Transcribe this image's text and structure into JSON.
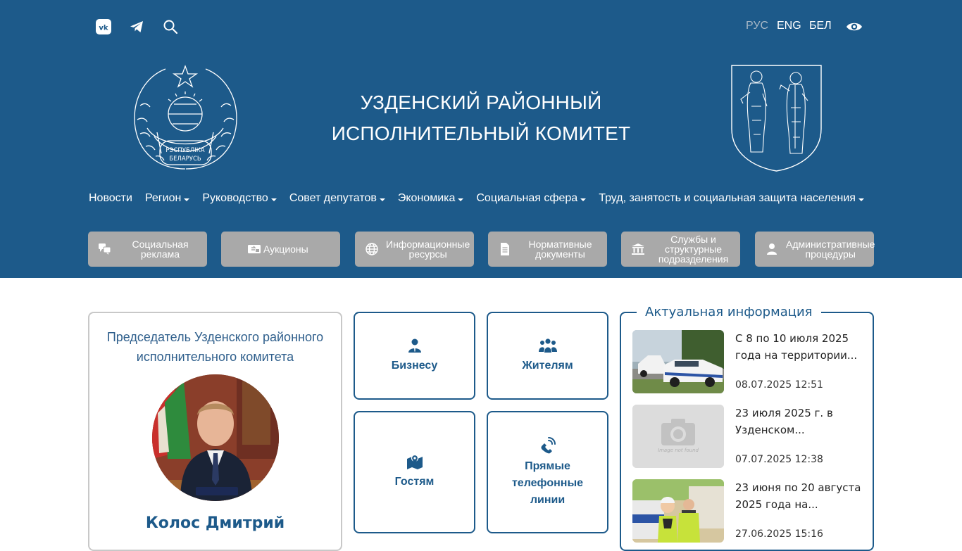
{
  "header": {
    "title_line1": "УЗДЕНСКИЙ РАЙОННЫЙ",
    "title_line2": "ИСПОЛНИТЕЛЬНЫЙ КОМИТЕТ",
    "emblem_text_line1": "РЭСПУБЛІКА",
    "emblem_text_line2": "БЕЛАРУСЬ",
    "languages": [
      {
        "label": "РУС",
        "active": true
      },
      {
        "label": "ENG",
        "active": false
      },
      {
        "label": "БЕЛ",
        "active": false
      }
    ],
    "icons": [
      "vk-icon",
      "telegram-icon",
      "search-icon",
      "eye-icon"
    ]
  },
  "nav": [
    {
      "label": "Новости",
      "dropdown": false
    },
    {
      "label": "Регион",
      "dropdown": true
    },
    {
      "label": "Руководство",
      "dropdown": true
    },
    {
      "label": "Совет депутатов",
      "dropdown": true
    },
    {
      "label": "Экономика",
      "dropdown": true
    },
    {
      "label": "Социальная сфера",
      "dropdown": true
    },
    {
      "label": "Труд, занятость и социальная защита населения",
      "dropdown": true
    }
  ],
  "quick_links": [
    {
      "label": "Социальная реклама",
      "icon": "chat-bubbles-icon"
    },
    {
      "label": "Аукционы",
      "icon": "auction-icon"
    },
    {
      "label": "Информационные ресурсы",
      "icon": "globe-icon"
    },
    {
      "label": "Нормативные документы",
      "icon": "document-icon"
    },
    {
      "label": "Службы и структурные подразделения",
      "icon": "institution-icon"
    },
    {
      "label": "Административные процедуры",
      "icon": "user-icon"
    }
  ],
  "chairman": {
    "title": "Председатель Узденского районного исполнительного комитета",
    "name": "Колос Дмитрий"
  },
  "tiles": [
    {
      "label": "Бизнесу",
      "icon": "business-person-icon"
    },
    {
      "label": "Жителям",
      "icon": "people-icon"
    },
    {
      "label": "Гостям",
      "icon": "map-pin-icon"
    },
    {
      "label": "Прямые телефонные линии",
      "icon": "phone-icon"
    }
  ],
  "news": {
    "heading": "Актуальная информация",
    "items": [
      {
        "text": "С 8 по 10 июля 2025 года на территории...",
        "date": "08.07.2025 12:51",
        "thumb": "police-cars-photo"
      },
      {
        "text": "23 июля 2025 г. в Узденском...",
        "date": "07.07.2025 12:38",
        "thumb": "placeholder-photo",
        "placeholder_text": "Image not found"
      },
      {
        "text": "23 июня по 20 августа 2025 года на...",
        "date": "27.06.2025 15:16",
        "thumb": "child-police-photo"
      }
    ]
  },
  "colors": {
    "header_bg": "#1d5a8a",
    "quick_btn_bg": "#a9a9a9",
    "accent": "#1d5a8a"
  }
}
